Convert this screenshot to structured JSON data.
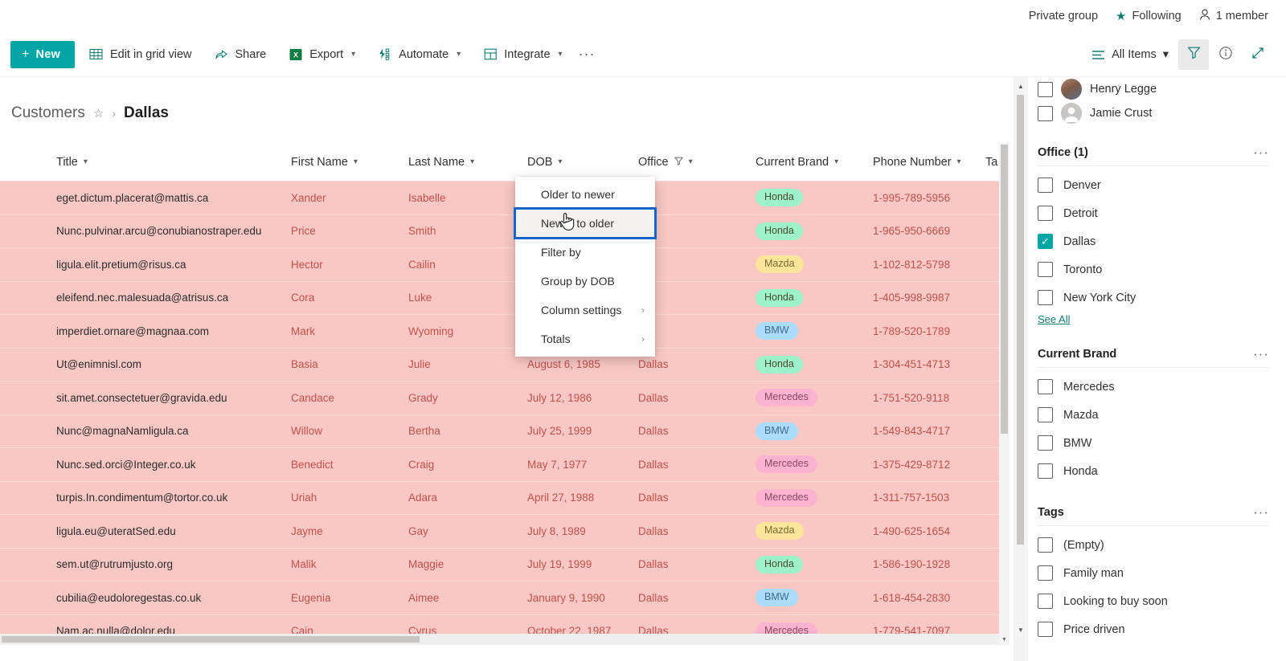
{
  "suitebar": {
    "private_group": "Private group",
    "following": "Following",
    "members": "1 member",
    "star_icon": "star-icon",
    "person_icon": "person-icon"
  },
  "commandbar": {
    "new_label": "New",
    "items": [
      {
        "label": "Edit in grid view",
        "icon": "grid-icon",
        "has_chevron": false
      },
      {
        "label": "Share",
        "icon": "share-icon",
        "has_chevron": false
      },
      {
        "label": "Export",
        "icon": "excel-icon",
        "has_chevron": true
      },
      {
        "label": "Automate",
        "icon": "automate-icon",
        "has_chevron": true
      },
      {
        "label": "Integrate",
        "icon": "integrate-icon",
        "has_chevron": true
      }
    ],
    "overflow": "···",
    "view_label": "All Items",
    "filter_icon": "filter-icon",
    "info_icon": "info-icon",
    "expand_icon": "expand-icon"
  },
  "breadcrumb": {
    "root": "Customers",
    "favorite_icon": "star-outline-icon",
    "separator": "›",
    "current": "Dallas"
  },
  "table": {
    "columns": [
      {
        "label": "Title",
        "filtered": false
      },
      {
        "label": "First Name",
        "filtered": false
      },
      {
        "label": "Last Name",
        "filtered": false
      },
      {
        "label": "DOB",
        "filtered": false
      },
      {
        "label": "Office",
        "filtered": true
      },
      {
        "label": "Current Brand",
        "filtered": false
      },
      {
        "label": "Phone Number",
        "filtered": false
      },
      {
        "label": "Ta",
        "filtered": false
      }
    ],
    "rows": [
      {
        "title": "eget.dictum.placerat@mattis.ca",
        "first": "Xander",
        "last": "Isabelle",
        "dob": "",
        "office": "las",
        "brand": "Honda",
        "phone": "1-995-789-5956"
      },
      {
        "title": "Nunc.pulvinar.arcu@conubianostraper.edu",
        "first": "Price",
        "last": "Smith",
        "dob": "",
        "office": "s",
        "brand": "Honda",
        "phone": "1-965-950-6669"
      },
      {
        "title": "ligula.elit.pretium@risus.ca",
        "first": "Hector",
        "last": "Cailin",
        "dob": "",
        "office": "las",
        "brand": "Mazda",
        "phone": "1-102-812-5798"
      },
      {
        "title": "eleifend.nec.malesuada@atrisus.ca",
        "first": "Cora",
        "last": "Luke",
        "dob": "",
        "office": "las",
        "brand": "Honda",
        "phone": "1-405-998-9987"
      },
      {
        "title": "imperdiet.ornare@magnaa.com",
        "first": "Mark",
        "last": "Wyoming",
        "dob": "",
        "office": "las",
        "brand": "BMW",
        "phone": "1-789-520-1789"
      },
      {
        "title": "Ut@enimnisl.com",
        "first": "Basia",
        "last": "Julie",
        "dob": "August 6, 1985",
        "office": "Dallas",
        "brand": "Honda",
        "phone": "1-304-451-4713"
      },
      {
        "title": "sit.amet.consectetuer@gravida.edu",
        "first": "Candace",
        "last": "Grady",
        "dob": "July 12, 1986",
        "office": "Dallas",
        "brand": "Mercedes",
        "phone": "1-751-520-9118"
      },
      {
        "title": "Nunc@magnaNamligula.ca",
        "first": "Willow",
        "last": "Bertha",
        "dob": "July 25, 1999",
        "office": "Dallas",
        "brand": "BMW",
        "phone": "1-549-843-4717"
      },
      {
        "title": "Nunc.sed.orci@Integer.co.uk",
        "first": "Benedict",
        "last": "Craig",
        "dob": "May 7, 1977",
        "office": "Dallas",
        "brand": "Mercedes",
        "phone": "1-375-429-8712"
      },
      {
        "title": "turpis.In.condimentum@tortor.co.uk",
        "first": "Uriah",
        "last": "Adara",
        "dob": "April 27, 1988",
        "office": "Dallas",
        "brand": "Mercedes",
        "phone": "1-311-757-1503"
      },
      {
        "title": "ligula.eu@uteratSed.edu",
        "first": "Jayme",
        "last": "Gay",
        "dob": "July 8, 1989",
        "office": "Dallas",
        "brand": "Mazda",
        "phone": "1-490-625-1654"
      },
      {
        "title": "sem.ut@rutrumjusto.org",
        "first": "Malik",
        "last": "Maggie",
        "dob": "July 19, 1999",
        "office": "Dallas",
        "brand": "Honda",
        "phone": "1-586-190-1928"
      },
      {
        "title": "cubilia@eudoloregestas.co.uk",
        "first": "Eugenia",
        "last": "Aimee",
        "dob": "January 9, 1990",
        "office": "Dallas",
        "brand": "BMW",
        "phone": "1-618-454-2830"
      },
      {
        "title": "Nam.ac.nulla@dolor.edu",
        "first": "Cain",
        "last": "Cyrus",
        "dob": "October 22, 1987",
        "office": "Dallas",
        "brand": "Mercedes",
        "phone": "1-779-541-7097"
      }
    ]
  },
  "context_menu": {
    "items": [
      {
        "label": "Older to newer",
        "submenu": false,
        "focused": false
      },
      {
        "label": "Newer to older",
        "submenu": false,
        "focused": true
      },
      {
        "label": "Filter by",
        "submenu": false,
        "focused": false
      },
      {
        "label": "Group by DOB",
        "submenu": false,
        "focused": false
      },
      {
        "label": "Column settings",
        "submenu": true,
        "focused": false
      },
      {
        "label": "Totals",
        "submenu": true,
        "focused": false
      }
    ],
    "submenu_chevron": "›"
  },
  "filter_pane": {
    "people": [
      {
        "name": "Henry Legge",
        "avatar": "photo",
        "checked": false
      },
      {
        "name": "Jamie Crust",
        "avatar": "generic",
        "checked": false
      }
    ],
    "sections": [
      {
        "title": "Office (1)",
        "options": [
          {
            "label": "Denver",
            "checked": false
          },
          {
            "label": "Detroit",
            "checked": false
          },
          {
            "label": "Dallas",
            "checked": true
          },
          {
            "label": "Toronto",
            "checked": false
          },
          {
            "label": "New York City",
            "checked": false
          }
        ],
        "see_all": "See All"
      },
      {
        "title": "Current Brand",
        "options": [
          {
            "label": "Mercedes",
            "checked": false
          },
          {
            "label": "Mazda",
            "checked": false
          },
          {
            "label": "BMW",
            "checked": false
          },
          {
            "label": "Honda",
            "checked": false
          }
        ],
        "see_all": ""
      },
      {
        "title": "Tags",
        "options": [
          {
            "label": "(Empty)",
            "checked": false
          },
          {
            "label": "Family man",
            "checked": false
          },
          {
            "label": "Looking to buy soon",
            "checked": false
          },
          {
            "label": "Price driven",
            "checked": false
          }
        ],
        "see_all": ""
      }
    ],
    "section_overflow": "···"
  },
  "colors": {
    "accent": "#03a5a5",
    "row_highlight": "#f9c8c4",
    "focus_ring": "#1466c8",
    "link": "#0f7b74"
  }
}
